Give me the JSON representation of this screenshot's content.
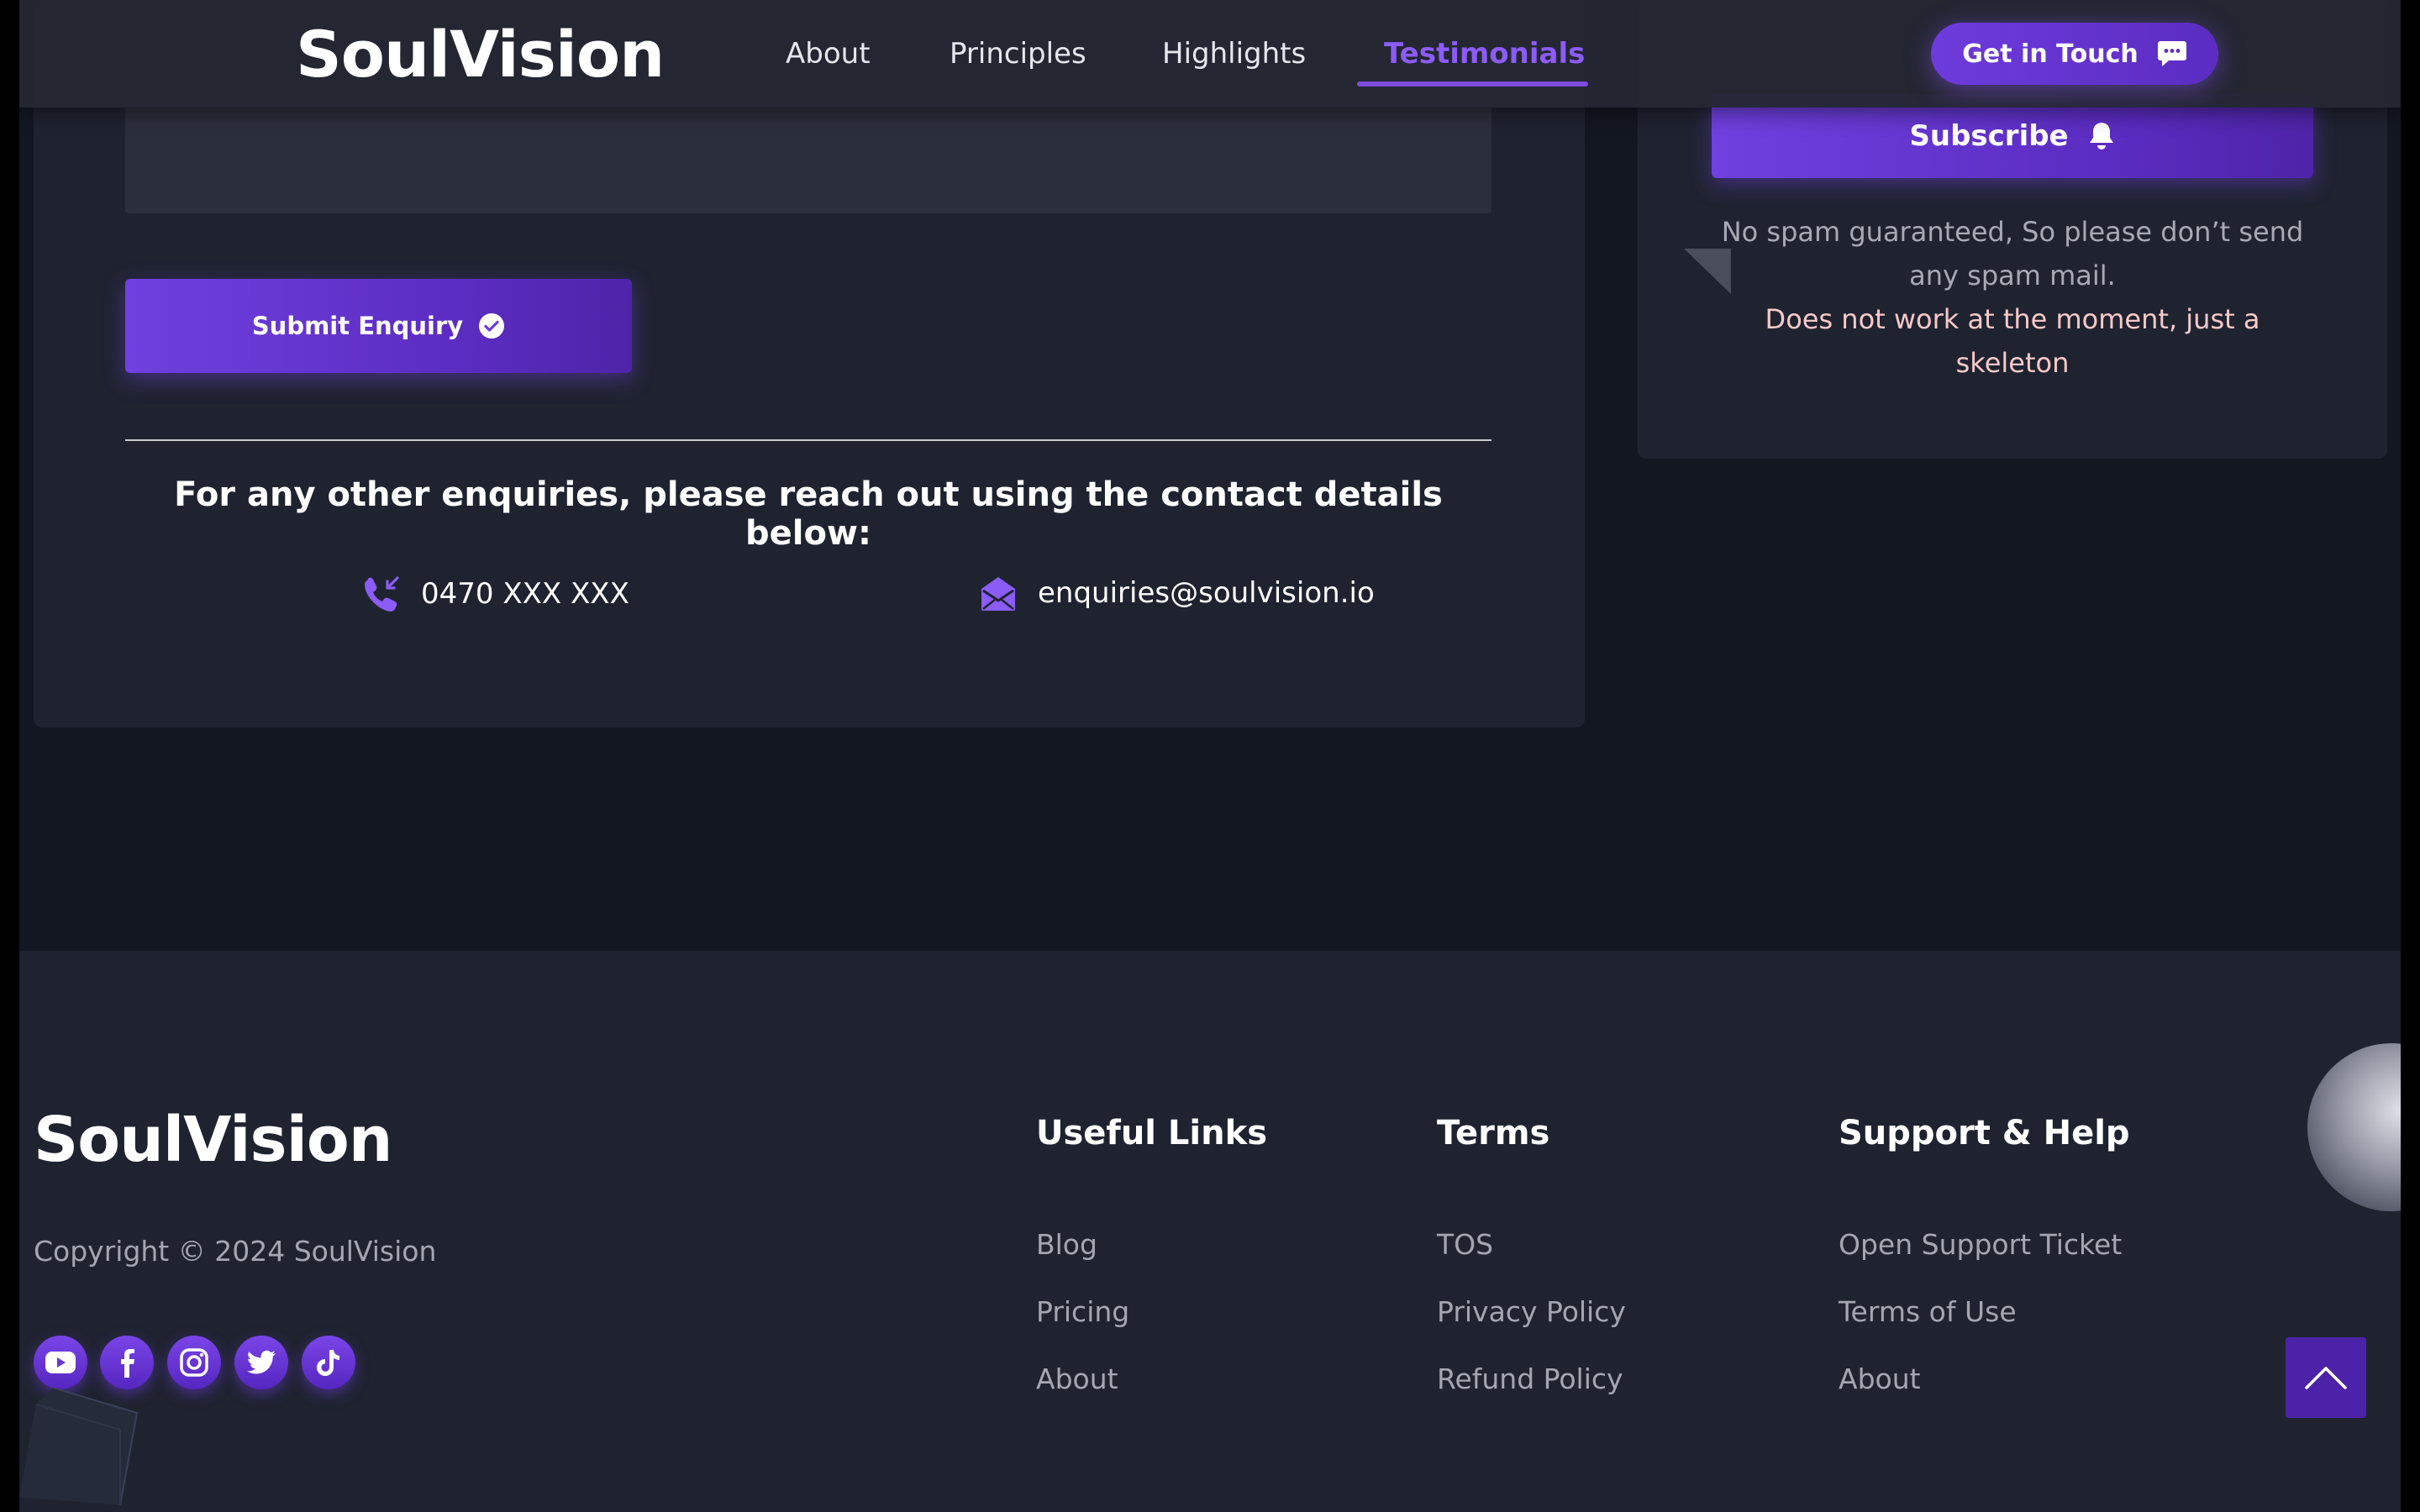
{
  "header": {
    "brand": "SoulVision",
    "nav": [
      {
        "label": "About"
      },
      {
        "label": "Principles"
      },
      {
        "label": "Highlights"
      },
      {
        "label": "Testimonials",
        "active": true
      }
    ],
    "cta_label": "Get in Touch",
    "cta_icon": "chat-bubble-icon"
  },
  "contact": {
    "submit_label": "Submit Enquiry",
    "submit_icon": "check-circle-icon",
    "heading": "For any other enquiries, please reach out using the contact details below:",
    "phone": "0470 XXX XXX",
    "phone_icon": "phone-incoming-icon",
    "email": "enquiries@soulvision.io",
    "email_icon": "envelope-open-icon"
  },
  "subscribe": {
    "button_label": "Subscribe",
    "button_icon": "bell-icon",
    "note": "No spam guaranteed, So please don’t send any spam mail.",
    "warning": "Does not work at the moment, just a skeleton"
  },
  "footer": {
    "brand": "SoulVision",
    "copyright": "Copyright © 2024 SoulVision",
    "socials": [
      "youtube-icon",
      "facebook-icon",
      "instagram-icon",
      "twitter-icon",
      "tiktok-icon"
    ],
    "columns": [
      {
        "title": "Useful Links",
        "links": [
          "Blog",
          "Pricing",
          "About"
        ]
      },
      {
        "title": "Terms",
        "links": [
          "TOS",
          "Privacy Policy",
          "Refund Policy"
        ]
      },
      {
        "title": "Support & Help",
        "links": [
          "Open Support Ticket",
          "Terms of Use",
          "About"
        ]
      }
    ],
    "scroll_top_icon": "chevron-up-icon"
  },
  "colors": {
    "accent": "#7c4ddb",
    "page_bg": "#131722",
    "card_bg": "#1f2330",
    "muted_text": "#a4a6b0",
    "warning_text": "#f9c9c9"
  }
}
